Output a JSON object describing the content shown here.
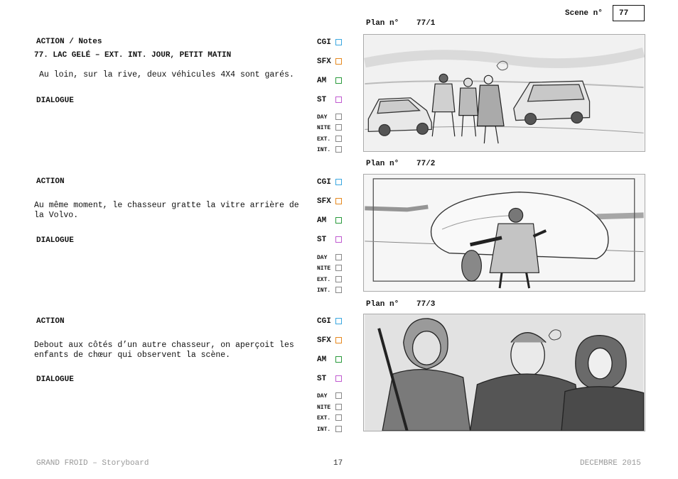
{
  "header": {
    "scene_label": "Scene n°",
    "scene_number": "77"
  },
  "checkbox_labels": {
    "cgi": "CGI",
    "sfx": "SFX",
    "am": "AM",
    "st": "ST",
    "day": "DAY",
    "nite": "NITE",
    "ext": "EXT.",
    "int": "INT."
  },
  "colors": {
    "cgi": "#3aa7e0",
    "sfx": "#e6891f",
    "am": "#2a9a3c",
    "st": "#c05ad0"
  },
  "panels": [
    {
      "plan_label": "Plan n°",
      "plan_number": "77/1",
      "action_heading": "ACTION / Notes",
      "scene_heading": "77. LAC GELÉ – EXT. INT. JOUR, PETIT MATIN",
      "action_text": "Au loin, sur la rive, deux véhicules 4X4 sont garés.",
      "dialogue_heading": "DIALOGUE",
      "sketch": "snowy-lake-two-4x4-vehicles-three-figures-icon"
    },
    {
      "plan_label": "Plan n°",
      "plan_number": "77/2",
      "action_heading": "ACTION",
      "action_text": "Au même moment, le chasseur gratte la vitre arrière de la Volvo.",
      "dialogue_heading": "DIALOGUE",
      "sketch": "hunter-scraping-snowy-car-icon"
    },
    {
      "plan_label": "Plan n°",
      "plan_number": "77/3",
      "action_heading": "ACTION",
      "action_text": "Debout aux côtés d’un autre chasseur, on aperçoit les enfants de chœur qui observent la scène.",
      "dialogue_heading": "DIALOGUE",
      "sketch": "hunter-and-choirboys-closeup-icon"
    }
  ],
  "footer": {
    "left": "GRAND FROID – Storyboard",
    "page": "17",
    "right": "DECEMBRE 2015"
  }
}
